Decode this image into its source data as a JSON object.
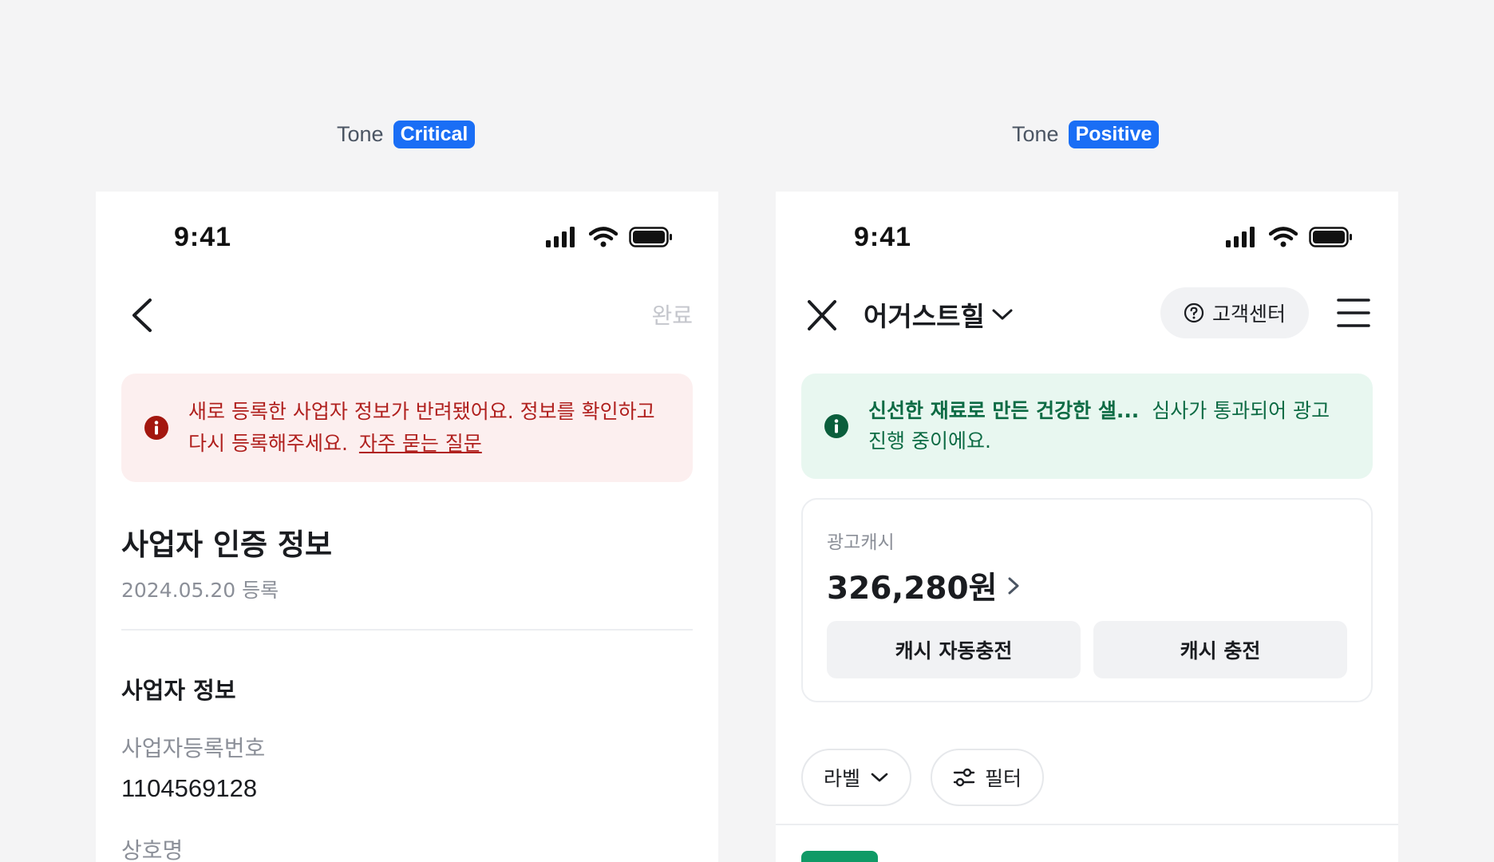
{
  "critical_panel": {
    "tone_label": "Tone",
    "tone_value": "Critical",
    "status_time": "9:41",
    "nav": {
      "done_label": "완료"
    },
    "callout": {
      "message": "새로 등록한 사업자 정보가 반려됐어요. 정보를 확인하고 다시 등록해주세요.",
      "link": "자주 묻는 질문"
    },
    "title": "사업자 인증 정보",
    "subtitle": "2024.05.20 등록",
    "section_title": "사업자 정보",
    "fields": [
      {
        "label": "사업자등록번호",
        "value": "1104569128"
      },
      {
        "label": "상호명",
        "value": ""
      }
    ]
  },
  "positive_panel": {
    "tone_label": "Tone",
    "tone_value": "Positive",
    "status_time": "9:41",
    "nav": {
      "title": "어거스트힐",
      "help_label": "고객센터"
    },
    "callout": {
      "strong": "신선한 재료로 만든 건강한 샐...",
      "message": "심사가 통과되어 광고 진행 중이에요."
    },
    "cash": {
      "label": "광고캐시",
      "amount": "326,280원",
      "auto_charge_label": "캐시 자동충전",
      "charge_label": "캐시 충전"
    },
    "chips": {
      "label_chip": "라벨",
      "filter_chip": "필터"
    }
  },
  "colors": {
    "badge": "#1a6ef5",
    "critical_bg": "#fcefef",
    "critical_text": "#b0201e",
    "positive_bg": "#e8f7f0",
    "positive_text": "#0d6b44",
    "tag_green": "#0f9a66"
  },
  "icons": {
    "back": "chevron-left-icon",
    "close": "close-icon",
    "dropdown": "chevron-down-icon",
    "help": "question-circle-icon",
    "menu": "hamburger-icon",
    "info_critical": "info-circle-icon",
    "info_positive": "info-circle-icon",
    "cash_arrow": "chevron-right-icon",
    "filter": "sliders-icon"
  }
}
